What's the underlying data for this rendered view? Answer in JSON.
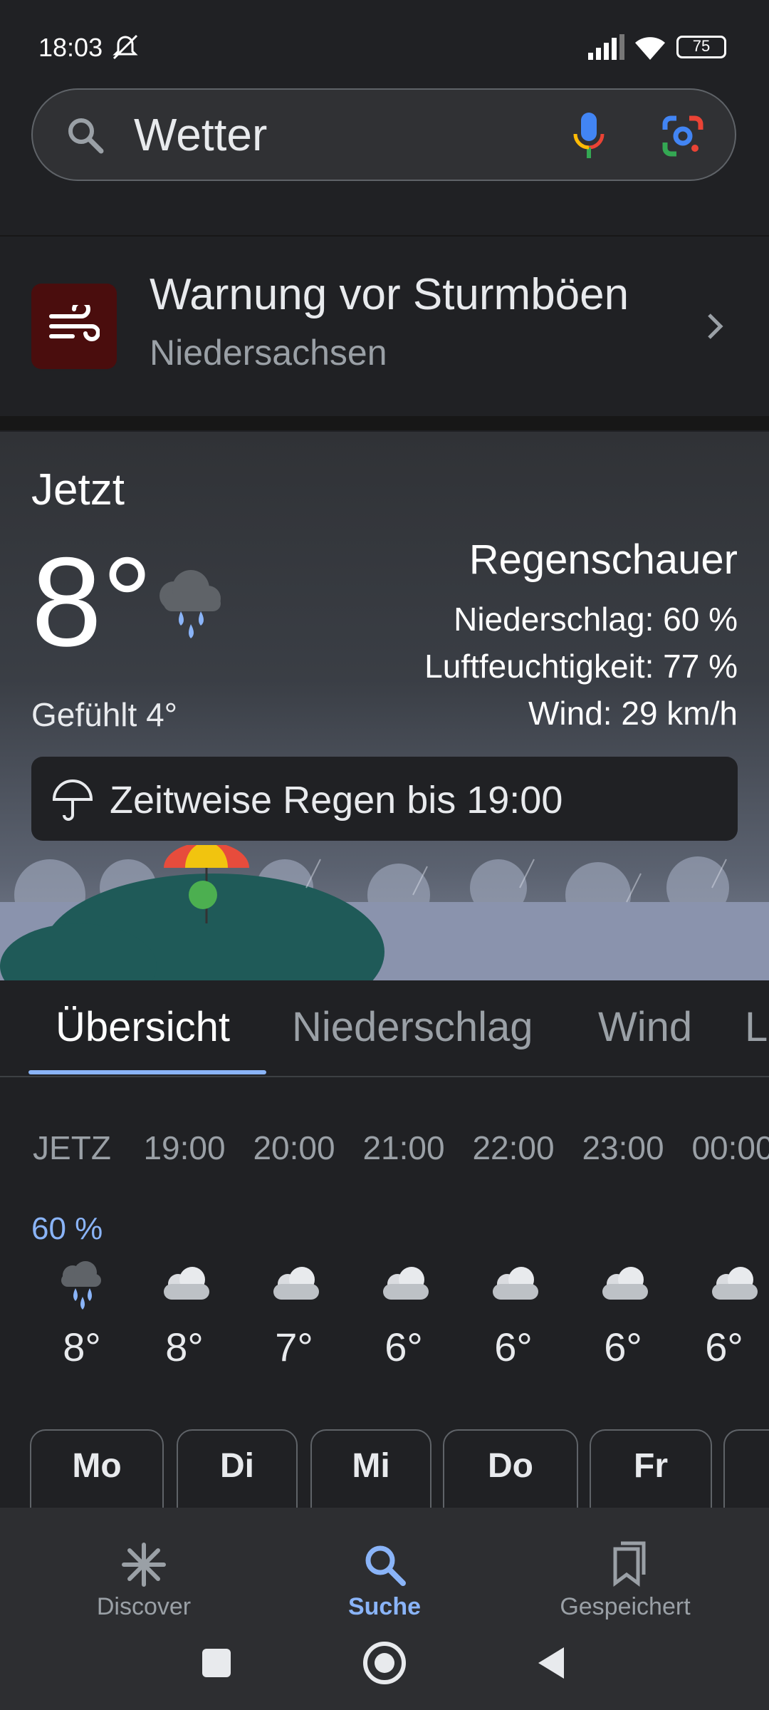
{
  "status_bar": {
    "time": "18:03",
    "battery": "75"
  },
  "search": {
    "query": "Wetter"
  },
  "warning": {
    "title": "Warnung vor Sturmböen",
    "region": "Niedersachsen"
  },
  "current": {
    "label": "Jetzt",
    "temperature": "8°",
    "feels_like": "Gefühlt 4°",
    "condition": "Regenschauer",
    "precipitation": "Niederschlag: 60 %",
    "humidity": "Luftfeuchtigkeit: 77 %",
    "wind": "Wind: 29 km/h",
    "rain_notice": "Zeitweise Regen bis 19:00"
  },
  "tabs": [
    "Übersicht",
    "Niederschlag",
    "Wind",
    "L"
  ],
  "hourly": {
    "precip_first": "60 %",
    "times": [
      "JETZ",
      "19:00",
      "20:00",
      "21:00",
      "22:00",
      "23:00",
      "00:00"
    ],
    "temps": [
      "8°",
      "8°",
      "7°",
      "6°",
      "6°",
      "6°",
      "6°"
    ],
    "icons": [
      "rain-cloud-icon",
      "cloud-icon",
      "cloud-icon",
      "cloud-icon",
      "cloud-icon",
      "cloud-icon",
      "cloud-icon"
    ]
  },
  "days": [
    "Mo",
    "Di",
    "Mi",
    "Do",
    "Fr"
  ],
  "bottom_nav": {
    "discover": "Discover",
    "search": "Suche",
    "saved": "Gespeichert"
  },
  "colors": {
    "accent": "#8ab4f8",
    "warning_bg": "#4a0d0d"
  }
}
